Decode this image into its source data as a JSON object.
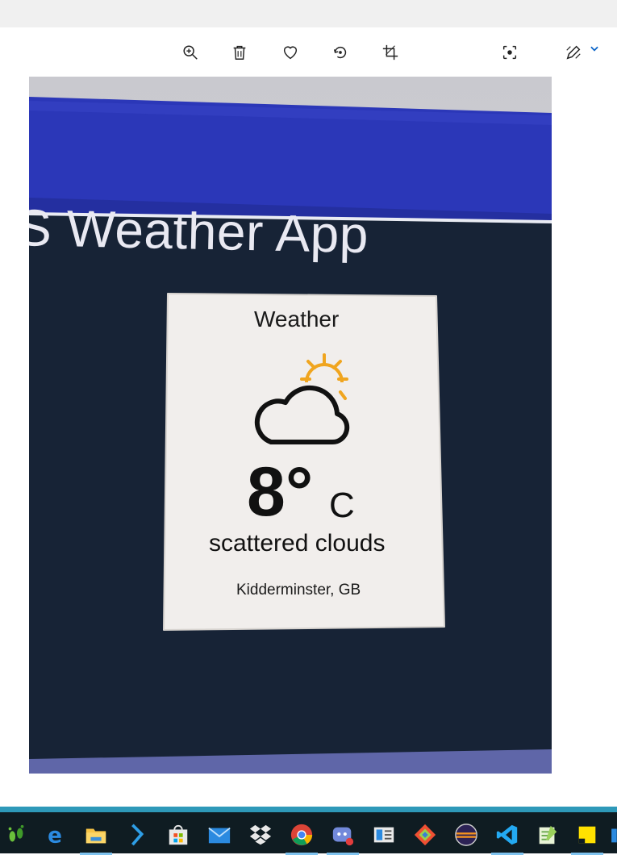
{
  "toolbar": {
    "buttons": [
      {
        "name": "zoom-in",
        "icon": "zoom-in-icon"
      },
      {
        "name": "delete",
        "icon": "trash-icon"
      },
      {
        "name": "favorite",
        "icon": "heart-icon"
      },
      {
        "name": "rotate",
        "icon": "rotate-icon"
      },
      {
        "name": "crop",
        "icon": "crop-icon"
      },
      {
        "name": "visual-search",
        "icon": "lens-icon"
      },
      {
        "name": "edit",
        "icon": "pen-icon"
      }
    ],
    "accent_color": "#0a64c8"
  },
  "photo": {
    "app_heading": "S Weather App",
    "header_color": "#2b37b8",
    "background_color": "#172336",
    "card": {
      "title": "Weather",
      "temperature": "8°",
      "unit": "C",
      "description": "scattered clouds",
      "location": "Kidderminster, GB"
    }
  },
  "taskbar": {
    "icons": [
      {
        "name": "footprints-app",
        "icon": "footprints-icon"
      },
      {
        "name": "edge",
        "icon": "edge-icon"
      },
      {
        "name": "file-explorer",
        "icon": "folder-icon",
        "active": true
      },
      {
        "name": "visual-studio",
        "icon": "vs-icon"
      },
      {
        "name": "store",
        "icon": "store-icon"
      },
      {
        "name": "mail",
        "icon": "mail-icon"
      },
      {
        "name": "dropbox",
        "icon": "dropbox-icon"
      },
      {
        "name": "chrome",
        "icon": "chrome-icon",
        "active": true
      },
      {
        "name": "discord",
        "icon": "discord-icon",
        "active": true
      },
      {
        "name": "reader",
        "icon": "reader-icon"
      },
      {
        "name": "git",
        "icon": "git-icon"
      },
      {
        "name": "eclipse",
        "icon": "eclipse-icon"
      },
      {
        "name": "vscode",
        "icon": "vscode-icon",
        "active": true
      },
      {
        "name": "notepad-plus",
        "icon": "notepad-icon"
      },
      {
        "name": "sticky-notes",
        "icon": "sticky-notes-icon",
        "active": true
      }
    ]
  }
}
